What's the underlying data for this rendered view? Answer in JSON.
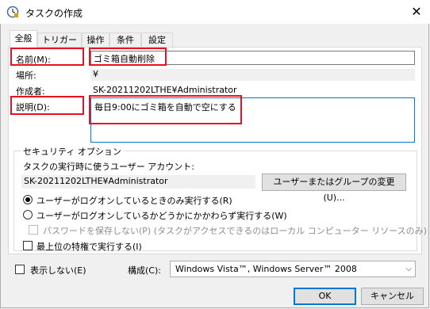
{
  "window": {
    "title": "タスクの作成"
  },
  "tabs": [
    {
      "label": "全般",
      "active": true
    },
    {
      "label": "トリガー"
    },
    {
      "label": "操作"
    },
    {
      "label": "条件"
    },
    {
      "label": "設定"
    }
  ],
  "general": {
    "name_label": "名前(M):",
    "name_value": "ゴミ箱自動削除",
    "location_label": "場所:",
    "location_value": "¥",
    "author_label": "作成者:",
    "author_value": "SK-20211202LTHE¥Administrator",
    "description_label": "説明(D):",
    "description_value": "毎日9:00にゴミ箱を自動で空にする"
  },
  "security": {
    "group_title": "セキュリティ オプション",
    "account_prompt": "タスクの実行時に使うユーザー アカウント:",
    "account_value": "SK-20211202LTHE¥Administrator",
    "change_button": "ユーザーまたはグループの変更(U)...",
    "radio_logged_on": "ユーザーがログオンしているときのみ実行する(R)",
    "radio_whether": "ユーザーがログオンしているかどうかにかかわらず実行する(W)",
    "no_store_password": "パスワードを保存しない(P) (タスクがアクセスできるのはローカル コンピューター リソースのみ)",
    "highest_privileges": "最上位の特権で実行する(I)"
  },
  "footer": {
    "hidden_label": "表示しない(E)",
    "configure_label": "構成(C):",
    "configure_value": "Windows Vista™, Windows Server™ 2008",
    "ok_button": "OK",
    "cancel_button": "キャンセル"
  },
  "colors": {
    "highlight_border": "#e81123",
    "focus_border": "#0078d7"
  }
}
